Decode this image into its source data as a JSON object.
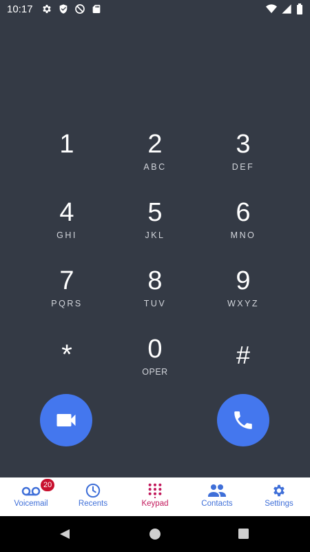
{
  "status_bar": {
    "time": "10:17",
    "left_icons": [
      "gear-icon",
      "shield-icon",
      "no-disturb-icon",
      "sd-card-icon"
    ],
    "right_icons": [
      "wifi-icon",
      "signal-icon",
      "battery-icon"
    ]
  },
  "keypad": {
    "keys": [
      {
        "digit": "1",
        "letters": ""
      },
      {
        "digit": "2",
        "letters": "ABC"
      },
      {
        "digit": "3",
        "letters": "DEF"
      },
      {
        "digit": "4",
        "letters": "GHI"
      },
      {
        "digit": "5",
        "letters": "JKL"
      },
      {
        "digit": "6",
        "letters": "MNO"
      },
      {
        "digit": "7",
        "letters": "PQRS"
      },
      {
        "digit": "8",
        "letters": "TUV"
      },
      {
        "digit": "9",
        "letters": "WXYZ"
      },
      {
        "digit": "*",
        "letters": ""
      },
      {
        "digit": "0",
        "letters": "OPER"
      },
      {
        "digit": "#",
        "letters": ""
      }
    ]
  },
  "actions": {
    "video_icon": "video-camera-icon",
    "call_icon": "phone-icon",
    "color": "#4477ee"
  },
  "bottom_nav": {
    "items": [
      {
        "label": "Voicemail",
        "icon": "voicemail-icon",
        "badge": "20"
      },
      {
        "label": "Recents",
        "icon": "clock-icon"
      },
      {
        "label": "Keypad",
        "icon": "dialpad-icon",
        "active": true
      },
      {
        "label": "Contacts",
        "icon": "people-icon"
      },
      {
        "label": "Settings",
        "icon": "gear-icon"
      }
    ],
    "active_color": "#c2185b",
    "color": "#3f6fd8"
  },
  "system_nav": {
    "buttons": [
      "back-icon",
      "home-icon",
      "recents-icon"
    ]
  }
}
